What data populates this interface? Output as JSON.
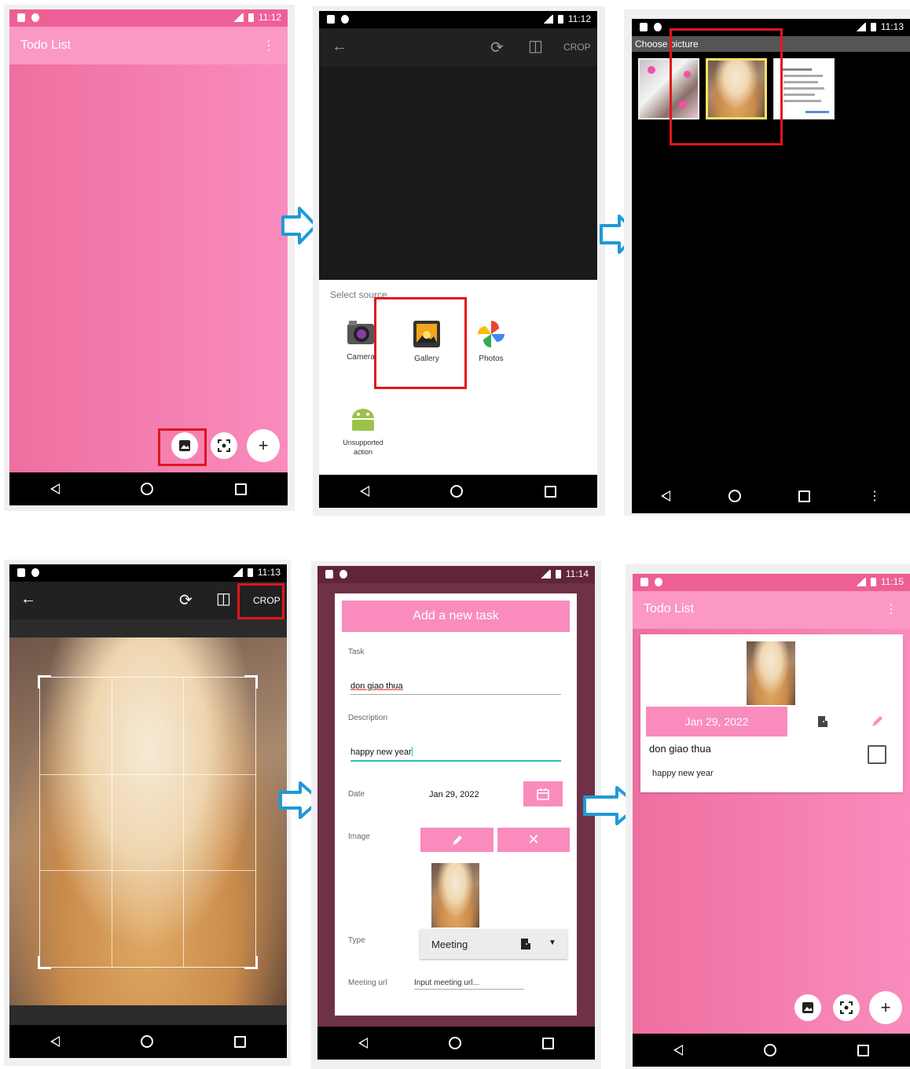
{
  "status": {
    "t1": "11:12",
    "t2": "11:12",
    "t3": "11:13",
    "t4": "11:13",
    "t5": "11:14",
    "t6": "11:15"
  },
  "screen1": {
    "app_title": "Todo List"
  },
  "screen2": {
    "crop_label": "CROP",
    "sheet_title": "Select source",
    "options": [
      {
        "label": "Camera"
      },
      {
        "label": "Gallery"
      },
      {
        "label": "Photos"
      },
      {
        "label": "Unsupported action"
      }
    ]
  },
  "screen3": {
    "title": "Choose picture"
  },
  "screen4": {
    "crop_label": "CROP"
  },
  "screen5": {
    "dialog_title": "Add a new task",
    "task_label": "Task",
    "task_value": "don giao thua",
    "description_label": "Description",
    "description_value": "happy new year",
    "date_label": "Date",
    "date_value": "Jan 29, 2022",
    "image_label": "Image",
    "type_label": "Type",
    "type_value": "Meeting",
    "meeting_url_label": "Meeting url",
    "meeting_url_placeholder": "Input meeting url..."
  },
  "screen6": {
    "app_title": "Todo List",
    "card_date": "Jan 29, 2022",
    "card_title": "don giao thua",
    "card_description": "happy new year"
  },
  "colors": {
    "pink": "#f98cbd",
    "pink_dark": "#ee6f9f",
    "highlight_red": "#e0161e",
    "arrow_blue": "#1e9ad6",
    "teal": "#26c6b4"
  }
}
